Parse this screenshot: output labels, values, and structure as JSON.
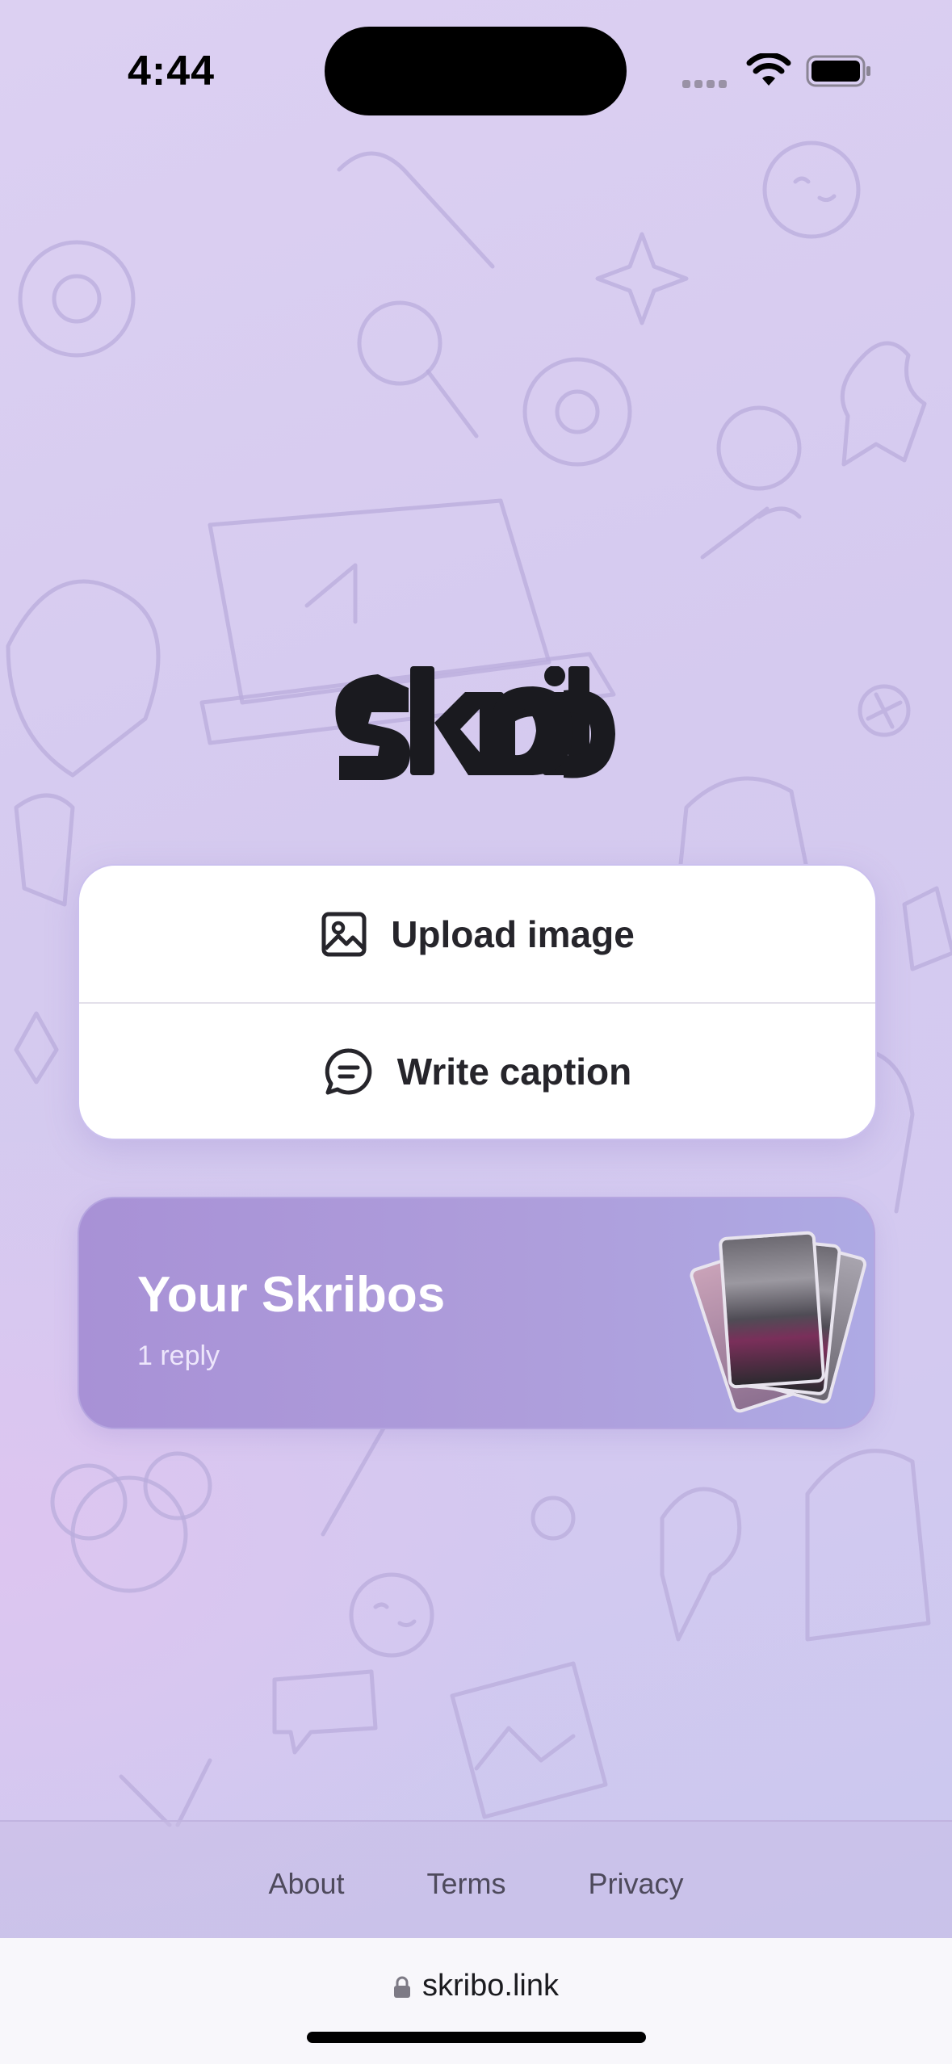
{
  "status_bar": {
    "time": "4:44"
  },
  "logo": {
    "text": "skribo"
  },
  "actions": [
    {
      "label": "Upload image",
      "icon": "image-icon"
    },
    {
      "label": "Write caption",
      "icon": "chat-bubble-icon"
    }
  ],
  "skribos": {
    "title": "Your Skribos",
    "subtitle": "1 reply"
  },
  "footer": {
    "links": [
      "About",
      "Terms",
      "Privacy"
    ]
  },
  "browser": {
    "url": "skribo.link"
  },
  "colors": {
    "accent": "#a891d6",
    "text": "#26252b",
    "background": "#dcd0f2"
  }
}
